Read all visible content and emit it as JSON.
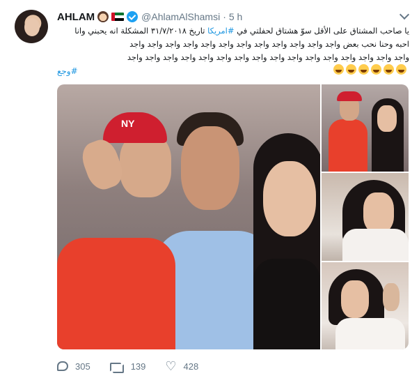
{
  "tweet": {
    "author_name": "AHLAM",
    "author_handle": "@AhlamAlShamsi",
    "separator": "·",
    "time": "5 h",
    "verified": true,
    "text_lines": [
      "يا صاحب المشتاق على الأقل سوّ هشتاق لحفلتي في",
      "#امريكا",
      "تاريخ ٣١/٧/٢٠١٨ المشكلة انه يحبني وانا",
      "احبه وحنا نحب بعض واجد واجد واجد واجد واجد واجد واجد  واجد واجد واجد واجد واجد",
      "واجد واجد واجد واجد واجد واجد واجد واجد واجد واجد واجد واجد واجد واجد واجد واجد",
      "#وجع"
    ],
    "emoji_count": 6
  },
  "media": {
    "cap_text": "NY"
  },
  "actions": {
    "replies": "305",
    "retweets": "139",
    "likes": "428"
  },
  "colors": {
    "link": "#1b95e0",
    "verified": "#1da1f2",
    "muted": "#657786"
  },
  "icons": [
    "avatar",
    "woman-emoji",
    "uae-flag-emoji",
    "verified-badge-icon",
    "chevron-down-icon",
    "face-with-tears-of-joy-emoji",
    "reply-icon",
    "retweet-icon",
    "heart-icon"
  ]
}
